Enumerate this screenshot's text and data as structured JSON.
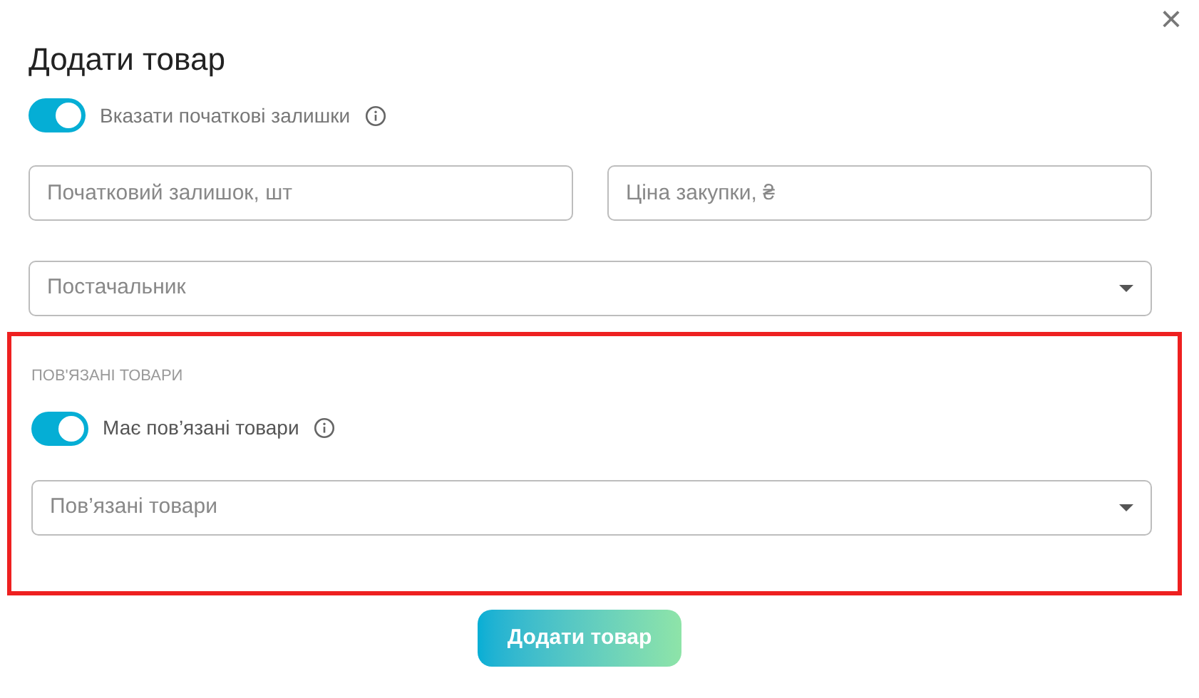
{
  "dialog": {
    "title": "Додати товар",
    "close_label": "×"
  },
  "stock_toggle": {
    "label": "Вказати початкові залишки",
    "on": true
  },
  "fields": [
    {
      "placeholder": "Початковий залишок, шт"
    },
    {
      "placeholder": "Ціна закупки, ₴"
    }
  ],
  "supplier_select": {
    "placeholder": "Постачальник"
  },
  "related_section": {
    "highlighted": true,
    "heading": "ПОВ'ЯЗАНІ ТОВАРИ",
    "toggle": {
      "label": "Має пов’язані товари",
      "on": true
    },
    "select": {
      "placeholder": "Пов’язані товари"
    }
  },
  "submit_button": {
    "label": "Додати товар"
  }
}
